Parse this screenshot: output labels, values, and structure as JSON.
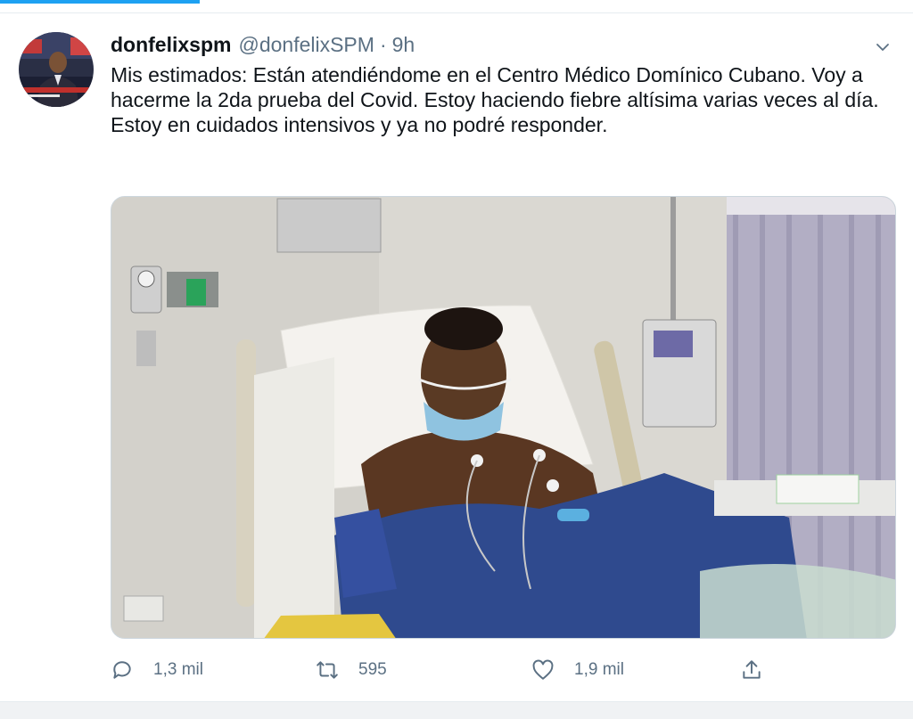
{
  "tweet": {
    "display_name": "donfelixspm",
    "handle": "@donfelixSPM",
    "separator": "·",
    "time": "9h",
    "text_lines": [
      "Mis estimados: Están atendiéndome en el Centro Médico Domínico Cubano. Voy a hacerme la 2da prueba del Covid. Estoy haciendo fiebre altísima varias veces al día.",
      "Estoy en cuidados intensivos y ya no podré responder."
    ],
    "media": {
      "description_icon": "photo",
      "colors": {
        "wall": "#dad8d2",
        "curtain": "#b2aec4",
        "gown": "#2f4a8e",
        "pillow": "#f4f2ee",
        "mask": "#8fc3e0"
      }
    }
  },
  "actions": {
    "reply": {
      "icon": "reply-icon",
      "count": "1,3 mil"
    },
    "retweet": {
      "icon": "retweet-icon",
      "count": "595"
    },
    "like": {
      "icon": "like-icon",
      "count": "1,9 mil"
    },
    "share": {
      "icon": "share-icon"
    }
  },
  "colors": {
    "accent": "#1da1f2",
    "secondary_text": "#5b7083",
    "border": "#ccd6dd"
  }
}
